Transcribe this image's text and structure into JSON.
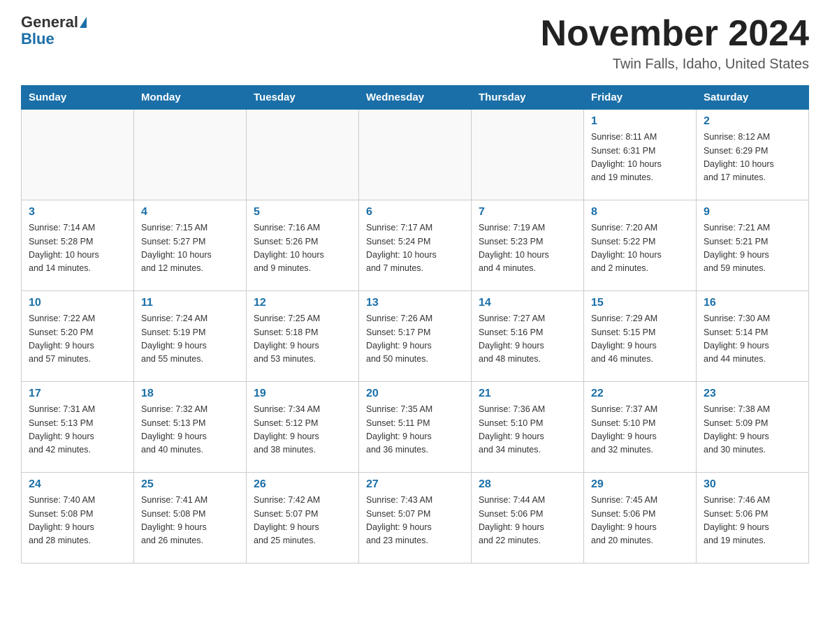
{
  "header": {
    "logo_general": "General",
    "logo_blue": "Blue",
    "title": "November 2024",
    "subtitle": "Twin Falls, Idaho, United States"
  },
  "days_of_week": [
    "Sunday",
    "Monday",
    "Tuesday",
    "Wednesday",
    "Thursday",
    "Friday",
    "Saturday"
  ],
  "weeks": [
    {
      "days": [
        {
          "num": "",
          "info": ""
        },
        {
          "num": "",
          "info": ""
        },
        {
          "num": "",
          "info": ""
        },
        {
          "num": "",
          "info": ""
        },
        {
          "num": "",
          "info": ""
        },
        {
          "num": "1",
          "info": "Sunrise: 8:11 AM\nSunset: 6:31 PM\nDaylight: 10 hours\nand 19 minutes."
        },
        {
          "num": "2",
          "info": "Sunrise: 8:12 AM\nSunset: 6:29 PM\nDaylight: 10 hours\nand 17 minutes."
        }
      ]
    },
    {
      "days": [
        {
          "num": "3",
          "info": "Sunrise: 7:14 AM\nSunset: 5:28 PM\nDaylight: 10 hours\nand 14 minutes."
        },
        {
          "num": "4",
          "info": "Sunrise: 7:15 AM\nSunset: 5:27 PM\nDaylight: 10 hours\nand 12 minutes."
        },
        {
          "num": "5",
          "info": "Sunrise: 7:16 AM\nSunset: 5:26 PM\nDaylight: 10 hours\nand 9 minutes."
        },
        {
          "num": "6",
          "info": "Sunrise: 7:17 AM\nSunset: 5:24 PM\nDaylight: 10 hours\nand 7 minutes."
        },
        {
          "num": "7",
          "info": "Sunrise: 7:19 AM\nSunset: 5:23 PM\nDaylight: 10 hours\nand 4 minutes."
        },
        {
          "num": "8",
          "info": "Sunrise: 7:20 AM\nSunset: 5:22 PM\nDaylight: 10 hours\nand 2 minutes."
        },
        {
          "num": "9",
          "info": "Sunrise: 7:21 AM\nSunset: 5:21 PM\nDaylight: 9 hours\nand 59 minutes."
        }
      ]
    },
    {
      "days": [
        {
          "num": "10",
          "info": "Sunrise: 7:22 AM\nSunset: 5:20 PM\nDaylight: 9 hours\nand 57 minutes."
        },
        {
          "num": "11",
          "info": "Sunrise: 7:24 AM\nSunset: 5:19 PM\nDaylight: 9 hours\nand 55 minutes."
        },
        {
          "num": "12",
          "info": "Sunrise: 7:25 AM\nSunset: 5:18 PM\nDaylight: 9 hours\nand 53 minutes."
        },
        {
          "num": "13",
          "info": "Sunrise: 7:26 AM\nSunset: 5:17 PM\nDaylight: 9 hours\nand 50 minutes."
        },
        {
          "num": "14",
          "info": "Sunrise: 7:27 AM\nSunset: 5:16 PM\nDaylight: 9 hours\nand 48 minutes."
        },
        {
          "num": "15",
          "info": "Sunrise: 7:29 AM\nSunset: 5:15 PM\nDaylight: 9 hours\nand 46 minutes."
        },
        {
          "num": "16",
          "info": "Sunrise: 7:30 AM\nSunset: 5:14 PM\nDaylight: 9 hours\nand 44 minutes."
        }
      ]
    },
    {
      "days": [
        {
          "num": "17",
          "info": "Sunrise: 7:31 AM\nSunset: 5:13 PM\nDaylight: 9 hours\nand 42 minutes."
        },
        {
          "num": "18",
          "info": "Sunrise: 7:32 AM\nSunset: 5:13 PM\nDaylight: 9 hours\nand 40 minutes."
        },
        {
          "num": "19",
          "info": "Sunrise: 7:34 AM\nSunset: 5:12 PM\nDaylight: 9 hours\nand 38 minutes."
        },
        {
          "num": "20",
          "info": "Sunrise: 7:35 AM\nSunset: 5:11 PM\nDaylight: 9 hours\nand 36 minutes."
        },
        {
          "num": "21",
          "info": "Sunrise: 7:36 AM\nSunset: 5:10 PM\nDaylight: 9 hours\nand 34 minutes."
        },
        {
          "num": "22",
          "info": "Sunrise: 7:37 AM\nSunset: 5:10 PM\nDaylight: 9 hours\nand 32 minutes."
        },
        {
          "num": "23",
          "info": "Sunrise: 7:38 AM\nSunset: 5:09 PM\nDaylight: 9 hours\nand 30 minutes."
        }
      ]
    },
    {
      "days": [
        {
          "num": "24",
          "info": "Sunrise: 7:40 AM\nSunset: 5:08 PM\nDaylight: 9 hours\nand 28 minutes."
        },
        {
          "num": "25",
          "info": "Sunrise: 7:41 AM\nSunset: 5:08 PM\nDaylight: 9 hours\nand 26 minutes."
        },
        {
          "num": "26",
          "info": "Sunrise: 7:42 AM\nSunset: 5:07 PM\nDaylight: 9 hours\nand 25 minutes."
        },
        {
          "num": "27",
          "info": "Sunrise: 7:43 AM\nSunset: 5:07 PM\nDaylight: 9 hours\nand 23 minutes."
        },
        {
          "num": "28",
          "info": "Sunrise: 7:44 AM\nSunset: 5:06 PM\nDaylight: 9 hours\nand 22 minutes."
        },
        {
          "num": "29",
          "info": "Sunrise: 7:45 AM\nSunset: 5:06 PM\nDaylight: 9 hours\nand 20 minutes."
        },
        {
          "num": "30",
          "info": "Sunrise: 7:46 AM\nSunset: 5:06 PM\nDaylight: 9 hours\nand 19 minutes."
        }
      ]
    }
  ]
}
